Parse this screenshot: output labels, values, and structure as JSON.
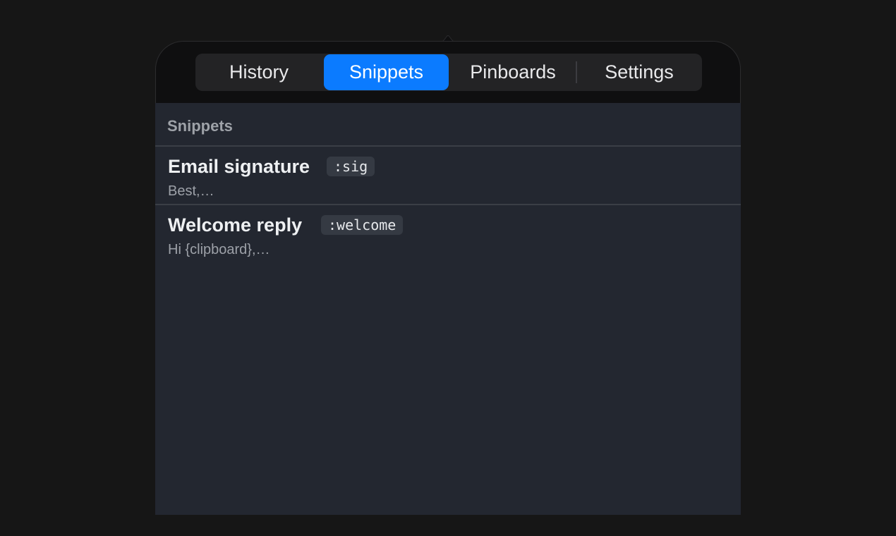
{
  "tabs": [
    {
      "label": "History",
      "active": false
    },
    {
      "label": "Snippets",
      "active": true
    },
    {
      "label": "Pinboards",
      "active": false
    },
    {
      "label": "Settings",
      "active": false
    }
  ],
  "section": {
    "title": "Snippets"
  },
  "snippets": [
    {
      "title": "Email signature",
      "keyword": ":sig",
      "preview": "Best,…"
    },
    {
      "title": "Welcome reply",
      "keyword": ":welcome",
      "preview": "Hi {clipboard},…"
    }
  ],
  "colors": {
    "accent": "#0b7bff",
    "background": "#161616",
    "panel": "#232730"
  }
}
